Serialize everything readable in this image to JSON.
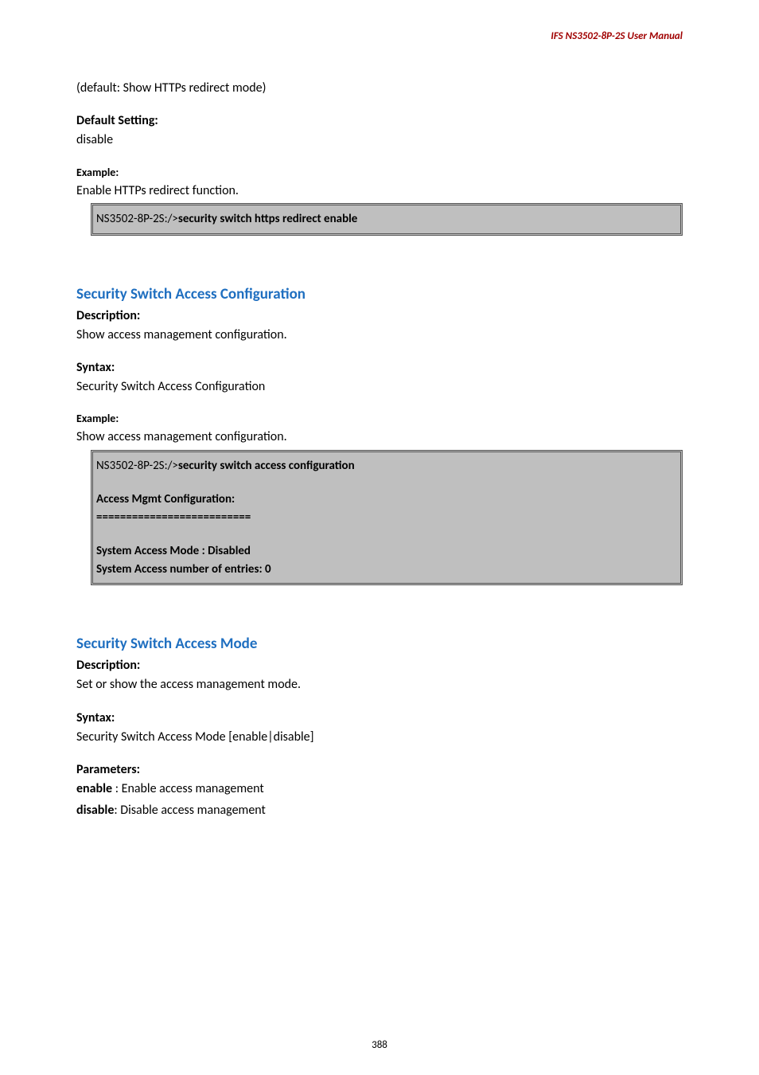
{
  "header": "IFS  NS3502-8P-2S  User  Manual",
  "block1": {
    "note": "(default: Show HTTPs redirect mode)",
    "default_label": "Default Setting:",
    "default_value": "disable",
    "example_label": "Example:",
    "example_desc": "Enable HTTPs redirect function.",
    "code_prefix": "NS3502-8P-2S:/>",
    "code_cmd": "security switch https redirect enable"
  },
  "section1": {
    "heading": "Security Switch Access Configuration",
    "desc_label": "Description:",
    "desc_value": "Show access management configuration.",
    "syntax_label": "Syntax:",
    "syntax_value": "Security Switch Access Configuration",
    "example_label": "Example:",
    "example_desc": "Show access management configuration.",
    "code_prefix": "NS3502-8P-2S:/>",
    "code_cmd": "security switch access configuration",
    "code_out1": "Access Mgmt Configuration:",
    "code_out2": "==========================",
    "code_out3": "System Access Mode : Disabled",
    "code_out4": "System Access number of entries: 0"
  },
  "section2": {
    "heading": "Security Switch Access Mode",
    "desc_label": "Description:",
    "desc_value": "Set or show the access management mode.",
    "syntax_label": "Syntax:",
    "syntax_value": "Security Switch Access Mode [enable|disable]",
    "params_label": "Parameters:",
    "param1_key": "enable",
    "param1_sep": " : ",
    "param1_val": "Enable access management",
    "param2_key": "disable",
    "param2_sep": ": ",
    "param2_val": "Disable access management"
  },
  "page_number": "388"
}
